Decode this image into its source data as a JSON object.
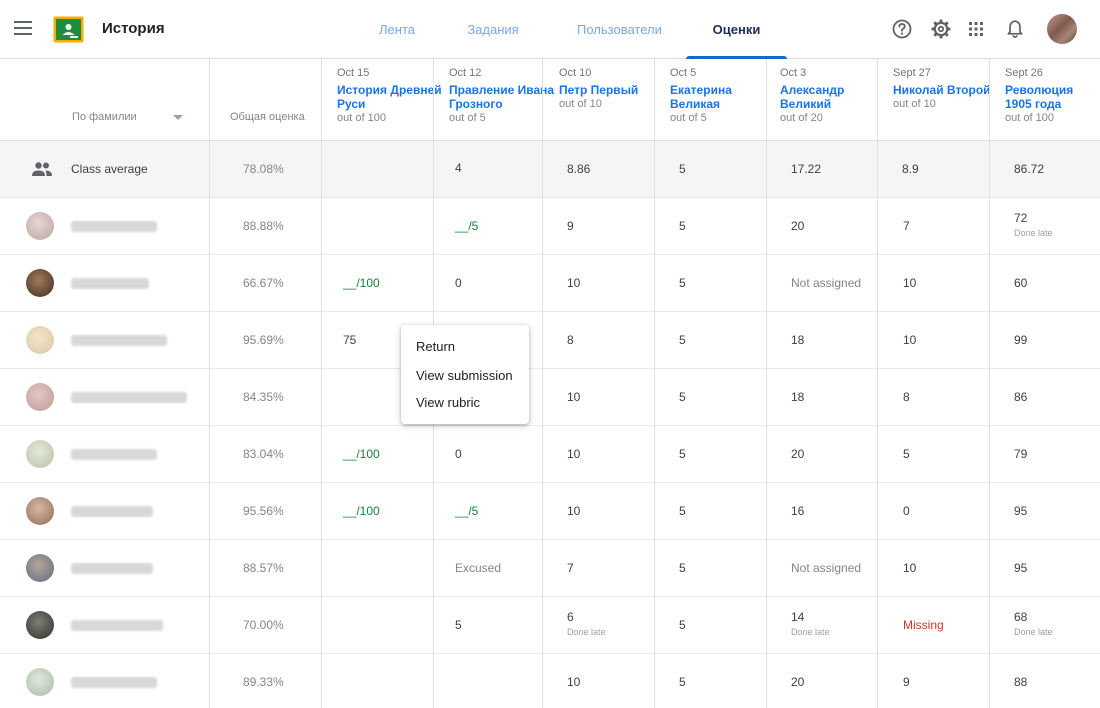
{
  "app": {
    "title": "История",
    "accent": "#1967d2",
    "logo_color": "#1e8e3e",
    "logo_border": "#f9ab00"
  },
  "tabs": [
    {
      "label": "Лента",
      "active": false
    },
    {
      "label": "Задания",
      "active": false
    },
    {
      "label": "Пользователи",
      "active": false
    },
    {
      "label": "Оценки",
      "active": true
    }
  ],
  "toolbar_icons": [
    "help-icon",
    "gear-icon",
    "apps-icon",
    "bell-icon"
  ],
  "header": {
    "sort_label": "По фамилии",
    "overall_label": "Общая оценка"
  },
  "assignments": [
    {
      "date": "Oct 15",
      "title": "История Древней Руси",
      "out_of": "out of 100"
    },
    {
      "date": "Oct 12",
      "title": "Правление Ивана Грозного",
      "out_of": "out of 5"
    },
    {
      "date": "Oct 10",
      "title": "Петр Первый",
      "out_of": "out of 10"
    },
    {
      "date": "Oct 5",
      "title": "Екатерина Великая",
      "out_of": "out of 5"
    },
    {
      "date": "Oct 3",
      "title": "Александр Великий",
      "out_of": "out of 20"
    },
    {
      "date": "Sept 27",
      "title": "Николай Второй",
      "out_of": "out of 10"
    },
    {
      "date": "Sept 26",
      "title": "Революция 1905 года",
      "out_of": "out of 100"
    }
  ],
  "class_average": {
    "label": "Class average",
    "overall": "78.08%",
    "grades": [
      "",
      "4",
      "8.86",
      "5",
      "17.22",
      "8.9",
      "86.72"
    ]
  },
  "students": [
    {
      "overall": "88.88%",
      "grades": [
        {
          "v": ""
        },
        {
          "v": "__/5",
          "style": "green"
        },
        {
          "v": "9"
        },
        {
          "v": "5"
        },
        {
          "v": "20"
        },
        {
          "v": "7"
        },
        {
          "v": "72",
          "note": "Done late"
        }
      ]
    },
    {
      "overall": "66.67%",
      "grades": [
        {
          "v": "__/100",
          "style": "green"
        },
        {
          "v": "0"
        },
        {
          "v": "10"
        },
        {
          "v": "5"
        },
        {
          "v": "Not assigned",
          "style": "grey"
        },
        {
          "v": "10"
        },
        {
          "v": "60"
        }
      ]
    },
    {
      "overall": "95.69%",
      "grades": [
        {
          "v": "75"
        },
        {
          "v": ""
        },
        {
          "v": "8"
        },
        {
          "v": "5"
        },
        {
          "v": "18"
        },
        {
          "v": "10"
        },
        {
          "v": "99"
        }
      ]
    },
    {
      "overall": "84.35%",
      "grades": [
        {
          "v": ""
        },
        {
          "v": ""
        },
        {
          "v": "10"
        },
        {
          "v": "5"
        },
        {
          "v": "18"
        },
        {
          "v": "8"
        },
        {
          "v": "86"
        }
      ]
    },
    {
      "overall": "83.04%",
      "grades": [
        {
          "v": "__/100",
          "style": "green"
        },
        {
          "v": "0"
        },
        {
          "v": "10"
        },
        {
          "v": "5"
        },
        {
          "v": "20"
        },
        {
          "v": "5"
        },
        {
          "v": "79"
        }
      ]
    },
    {
      "overall": "95.56%",
      "grades": [
        {
          "v": "__/100",
          "style": "green"
        },
        {
          "v": "__/5",
          "style": "green"
        },
        {
          "v": "10"
        },
        {
          "v": "5"
        },
        {
          "v": "16"
        },
        {
          "v": "0"
        },
        {
          "v": "95"
        }
      ]
    },
    {
      "overall": "88.57%",
      "grades": [
        {
          "v": ""
        },
        {
          "v": "Excused",
          "style": "grey"
        },
        {
          "v": "7"
        },
        {
          "v": "5"
        },
        {
          "v": "Not assigned",
          "style": "grey"
        },
        {
          "v": "10"
        },
        {
          "v": "95"
        }
      ]
    },
    {
      "overall": "70.00%",
      "grades": [
        {
          "v": ""
        },
        {
          "v": "5"
        },
        {
          "v": "6",
          "note": "Done late"
        },
        {
          "v": "5"
        },
        {
          "v": "14",
          "note": "Done late"
        },
        {
          "v": "Missing",
          "style": "red"
        },
        {
          "v": "68",
          "note": "Done late"
        }
      ]
    },
    {
      "overall": "89.33%",
      "grades": [
        {
          "v": ""
        },
        {
          "v": ""
        },
        {
          "v": "10"
        },
        {
          "v": "5"
        },
        {
          "v": "20"
        },
        {
          "v": "9"
        },
        {
          "v": "88"
        }
      ]
    }
  ],
  "context_menu": {
    "items": [
      "Return",
      "View submission",
      "View rubric"
    ]
  }
}
